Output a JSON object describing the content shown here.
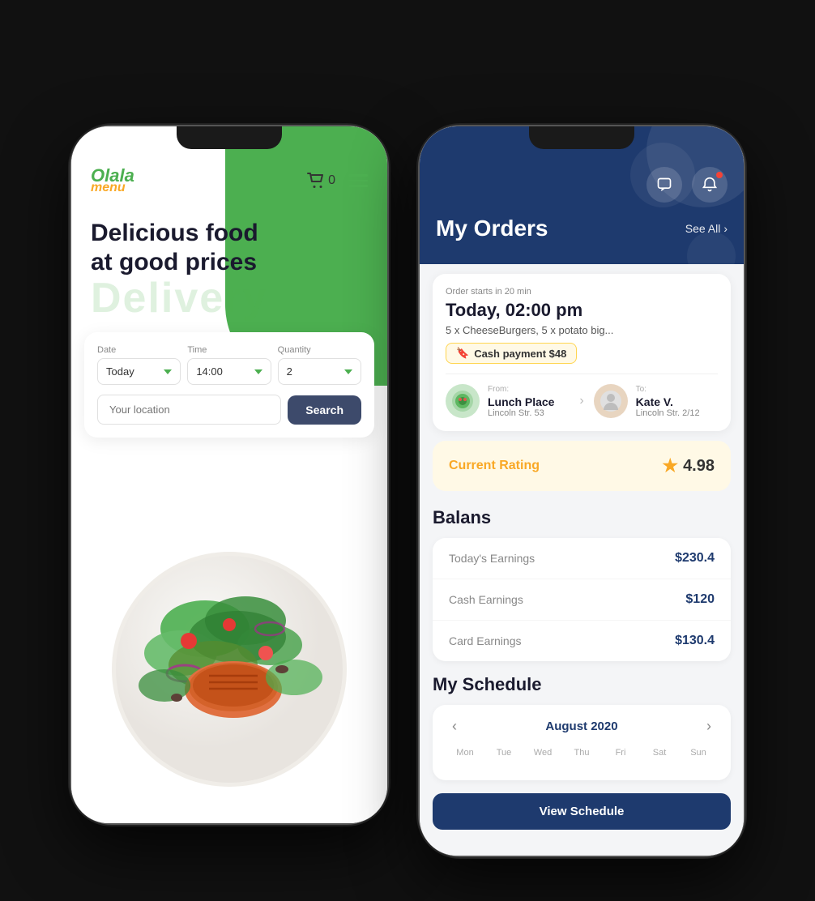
{
  "phone1": {
    "logo": {
      "brand": "Olala",
      "sub": "menu"
    },
    "cart": {
      "count": "0"
    },
    "hero": {
      "title": "Delicious food at good prices",
      "watermark": "Delivery"
    },
    "form": {
      "date_label": "Date",
      "date_value": "Today",
      "time_label": "Time",
      "time_value": "14:00",
      "qty_label": "Quantity",
      "qty_value": "2",
      "location_placeholder": "Your location",
      "search_button": "Search"
    }
  },
  "phone2": {
    "header": {
      "title": "My Orders",
      "see_all": "See All"
    },
    "order": {
      "starts_text": "Order starts in 20 min",
      "time": "Today, 02:00 pm",
      "items": "5 x CheeseBurgers, 5 x potato big...",
      "payment": "Cash payment $48",
      "from_label": "From:",
      "from_name": "Lunch Place",
      "from_address": "Lincoln Str. 53",
      "to_label": "To:",
      "to_name": "Kate V.",
      "to_address": "Lincoln Str. 2/12"
    },
    "rating": {
      "label": "Current Rating",
      "value": "4.98"
    },
    "balance": {
      "title": "Balans",
      "rows": [
        {
          "label": "Today's Earnings",
          "value": "$230.4"
        },
        {
          "label": "Cash Earnings",
          "value": "$120"
        },
        {
          "label": "Card Earnings",
          "value": "$130.4"
        }
      ]
    },
    "schedule": {
      "title": "My Schedule",
      "month": "August 2020",
      "days": [
        "Mon",
        "Tue",
        "Wed",
        "Thu",
        "Fri",
        "Sat",
        "Sun"
      ]
    },
    "action_button": "View Schedule"
  }
}
